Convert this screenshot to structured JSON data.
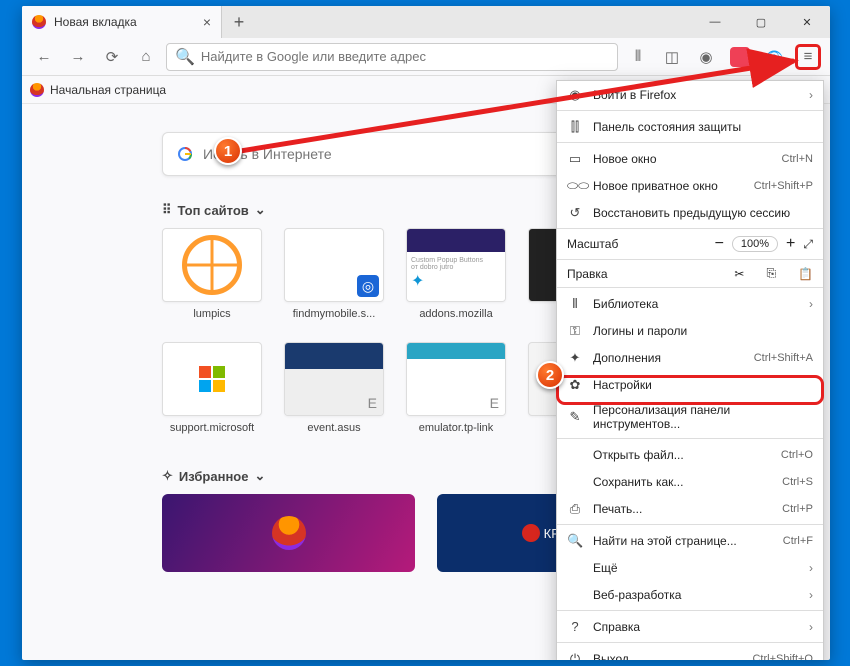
{
  "tab": {
    "title": "Новая вкладка"
  },
  "urlbar": {
    "placeholder": "Найдите в Google или введите адрес"
  },
  "bookmark": {
    "label": "Начальная страница"
  },
  "search": {
    "placeholder": "Искать в Интернете"
  },
  "sections": {
    "top": "Топ сайтов",
    "fav": "Избранное"
  },
  "tiles": [
    {
      "label": "lumpics"
    },
    {
      "label": "findmymobile.s..."
    },
    {
      "label": "addons.mozilla"
    },
    {
      "label": ""
    },
    {
      "label": "support.microsoft"
    },
    {
      "label": "event.asus"
    },
    {
      "label": "emulator.tp-link"
    },
    {
      "label": ""
    }
  ],
  "menu": {
    "signin": "Войти в Firefox",
    "protection": "Панель состояния защиты",
    "newwin": {
      "label": "Новое окно",
      "sc": "Ctrl+N"
    },
    "newpriv": {
      "label": "Новое приватное окно",
      "sc": "Ctrl+Shift+P"
    },
    "restore": "Восстановить предыдущую сессию",
    "zoom": {
      "label": "Масштаб",
      "value": "100%"
    },
    "edit": "Правка",
    "library": "Библиотека",
    "logins": "Логины и пароли",
    "addons": {
      "label": "Дополнения",
      "sc": "Ctrl+Shift+A"
    },
    "settings": "Настройки",
    "customize": "Персонализация панели инструментов...",
    "open": {
      "label": "Открыть файл...",
      "sc": "Ctrl+O"
    },
    "save": {
      "label": "Сохранить как...",
      "sc": "Ctrl+S"
    },
    "print": {
      "label": "Печать...",
      "sc": "Ctrl+P"
    },
    "find": {
      "label": "Найти на этой странице...",
      "sc": "Ctrl+F"
    },
    "more": "Ещё",
    "webdev": "Веб-разработка",
    "help": "Справка",
    "exit": {
      "label": "Выход",
      "sc": "Ctrl+Shift+Q"
    }
  },
  "badges": {
    "step1": "1",
    "step2": "2"
  },
  "promo2": "КРИПТОП"
}
